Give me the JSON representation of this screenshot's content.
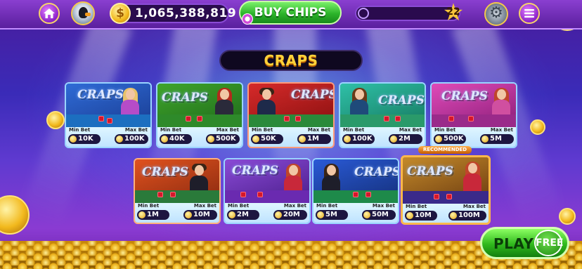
{
  "header": {
    "balance": "1,065,388,819",
    "coin_symbol": "$",
    "buy_chips_label": "BUY CHIPS",
    "level": "22"
  },
  "title": "CRAPS",
  "tables": [
    {
      "logo": "CRAPS",
      "min_label": "Min Bet",
      "max_label": "Max Bet",
      "min_bet": "10K",
      "max_bet": "100K"
    },
    {
      "logo": "CRAPS",
      "min_label": "Min Bet",
      "max_label": "Max Bet",
      "min_bet": "40K",
      "max_bet": "500K"
    },
    {
      "logo": "CRAPS",
      "min_label": "Min Bet",
      "max_label": "Max Bet",
      "min_bet": "50K",
      "max_bet": "1M"
    },
    {
      "logo": "CRAPS",
      "min_label": "Min Bet",
      "max_label": "Max Bet",
      "min_bet": "100K",
      "max_bet": "2M"
    },
    {
      "logo": "CRAPS",
      "min_label": "Min Bet",
      "max_label": "Max Bet",
      "min_bet": "500K",
      "max_bet": "5M"
    },
    {
      "logo": "CRAPS",
      "min_label": "Min Bet",
      "max_label": "Max Bet",
      "min_bet": "1M",
      "max_bet": "10M"
    },
    {
      "logo": "CRAPS",
      "min_label": "Min Bet",
      "max_label": "Max Bet",
      "min_bet": "2M",
      "max_bet": "20M"
    },
    {
      "logo": "CRAPS",
      "min_label": "Min Bet",
      "max_label": "Max Bet",
      "min_bet": "5M",
      "max_bet": "50M"
    },
    {
      "logo": "CRAPS",
      "min_label": "Min Bet",
      "max_label": "Max Bet",
      "min_bet": "10M",
      "max_bet": "100M"
    }
  ],
  "recommended_label": "RECOMMENDED",
  "play_free": {
    "play": "PLAY",
    "free": "FREE"
  },
  "colors": {
    "accent_gold": "#ffd23a",
    "buy_green": "#2cb42a",
    "topbar_purple": "#5a1f9e"
  },
  "icons": [
    "home-icon",
    "avatar-penguin-icon",
    "coin-icon",
    "chip-icon",
    "user-icon",
    "star-icon",
    "settings-icon",
    "menu-icon"
  ]
}
